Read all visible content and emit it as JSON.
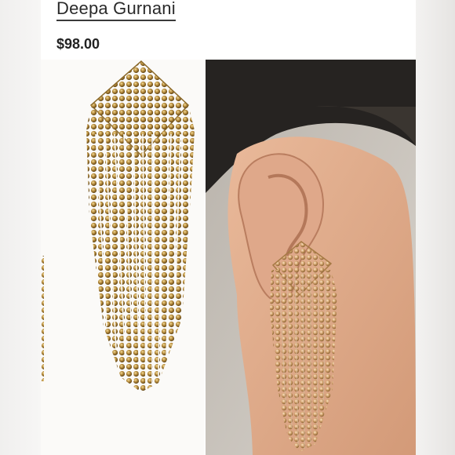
{
  "product": {
    "brand": "Deepa Gurnani",
    "price": "$98.00"
  },
  "images": [
    {
      "icon": "earring-product-photo"
    },
    {
      "icon": "earring-model-photo"
    }
  ]
}
